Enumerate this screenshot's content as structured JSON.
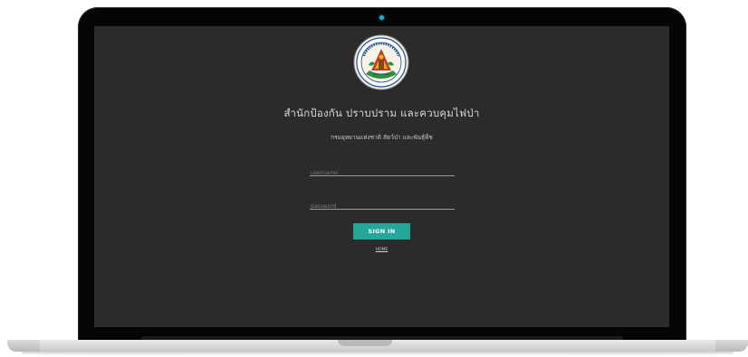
{
  "login": {
    "org_title": "สำนักป้องกัน ปราบปราม และควบคุมไฟป่า",
    "org_subtitle": "กรมอุทยานแห่งชาติ สัตว์ป่า และพันธุ์พืช",
    "username_placeholder": "username",
    "username_value": "",
    "password_placeholder": "password",
    "password_value": "",
    "signin_label": "SIGN IN",
    "home_label": "HOME"
  },
  "emblem": {
    "icon": "department-seal-icon"
  },
  "colors": {
    "screen_background": "#2b2b2b",
    "accent": "#26a69a",
    "bezel": "#050505",
    "camera": "#1ea7d8"
  }
}
